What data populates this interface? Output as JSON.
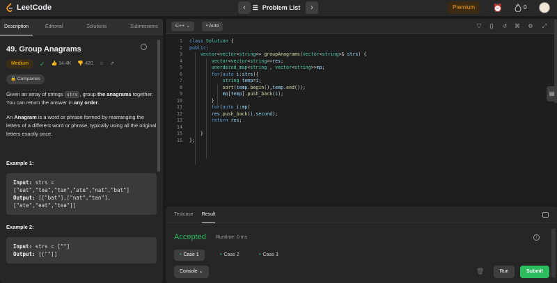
{
  "topbar": {
    "brand": "LeetCode",
    "problem_list": "Problem List",
    "premium": "Premium",
    "streak": "0",
    "prev_icon": "chevron-left-icon",
    "next_icon": "chevron-right-icon",
    "accent": "#ffa116"
  },
  "left_tabs": [
    "Description",
    "Editorial",
    "Solutions",
    "Submissions"
  ],
  "problem": {
    "title": "49. Group Anagrams",
    "difficulty": "Medium",
    "likes": "14.4K",
    "dislikes": "420",
    "companies": "Companies",
    "desc_1a": "Given an array of strings ",
    "desc_1code": "strs",
    "desc_1b": ", group ",
    "desc_1bold": "the anagrams",
    "desc_1c": " together. You can return the answer in ",
    "desc_1bold2": "any order",
    "desc_1d": ".",
    "desc_2bold": "Anagram",
    "desc_2": " is a word or phrase formed by rearranging the letters of a different word or phrase, typically using all the original letters exactly once.",
    "desc_2pre": "An "
  },
  "examples": [
    {
      "title": "Example 1:",
      "input_label": "Input:",
      "input": " strs = [\"eat\",\"tea\",\"tan\",\"ate\",\"nat\",\"bat\"]",
      "output_label": "Output:",
      "output": " [[\"bat\"],[\"nat\",\"tan\"],[\"ate\",\"eat\",\"tea\"]]"
    },
    {
      "title": "Example 2:",
      "input_label": "Input:",
      "input": " strs = [\"\"]",
      "output_label": "Output:",
      "output": " [[\"\"]]"
    }
  ],
  "editor": {
    "language": "C++",
    "mode": "Auto",
    "line_numbers": [
      "1",
      "2",
      "3",
      "4",
      "5",
      "6",
      "7",
      "8",
      "9",
      "10",
      "11",
      "12",
      "13",
      "14",
      "15",
      "16"
    ]
  },
  "console": {
    "tabs": [
      "Testcase",
      "Result"
    ],
    "status": "Accepted",
    "runtime": "Runtime: 0 ms",
    "cases": [
      "Case 1",
      "Case 2",
      "Case 3"
    ],
    "console_label": "Console",
    "run": "Run",
    "submit": "Submit",
    "success_color": "#2cbb5d"
  }
}
